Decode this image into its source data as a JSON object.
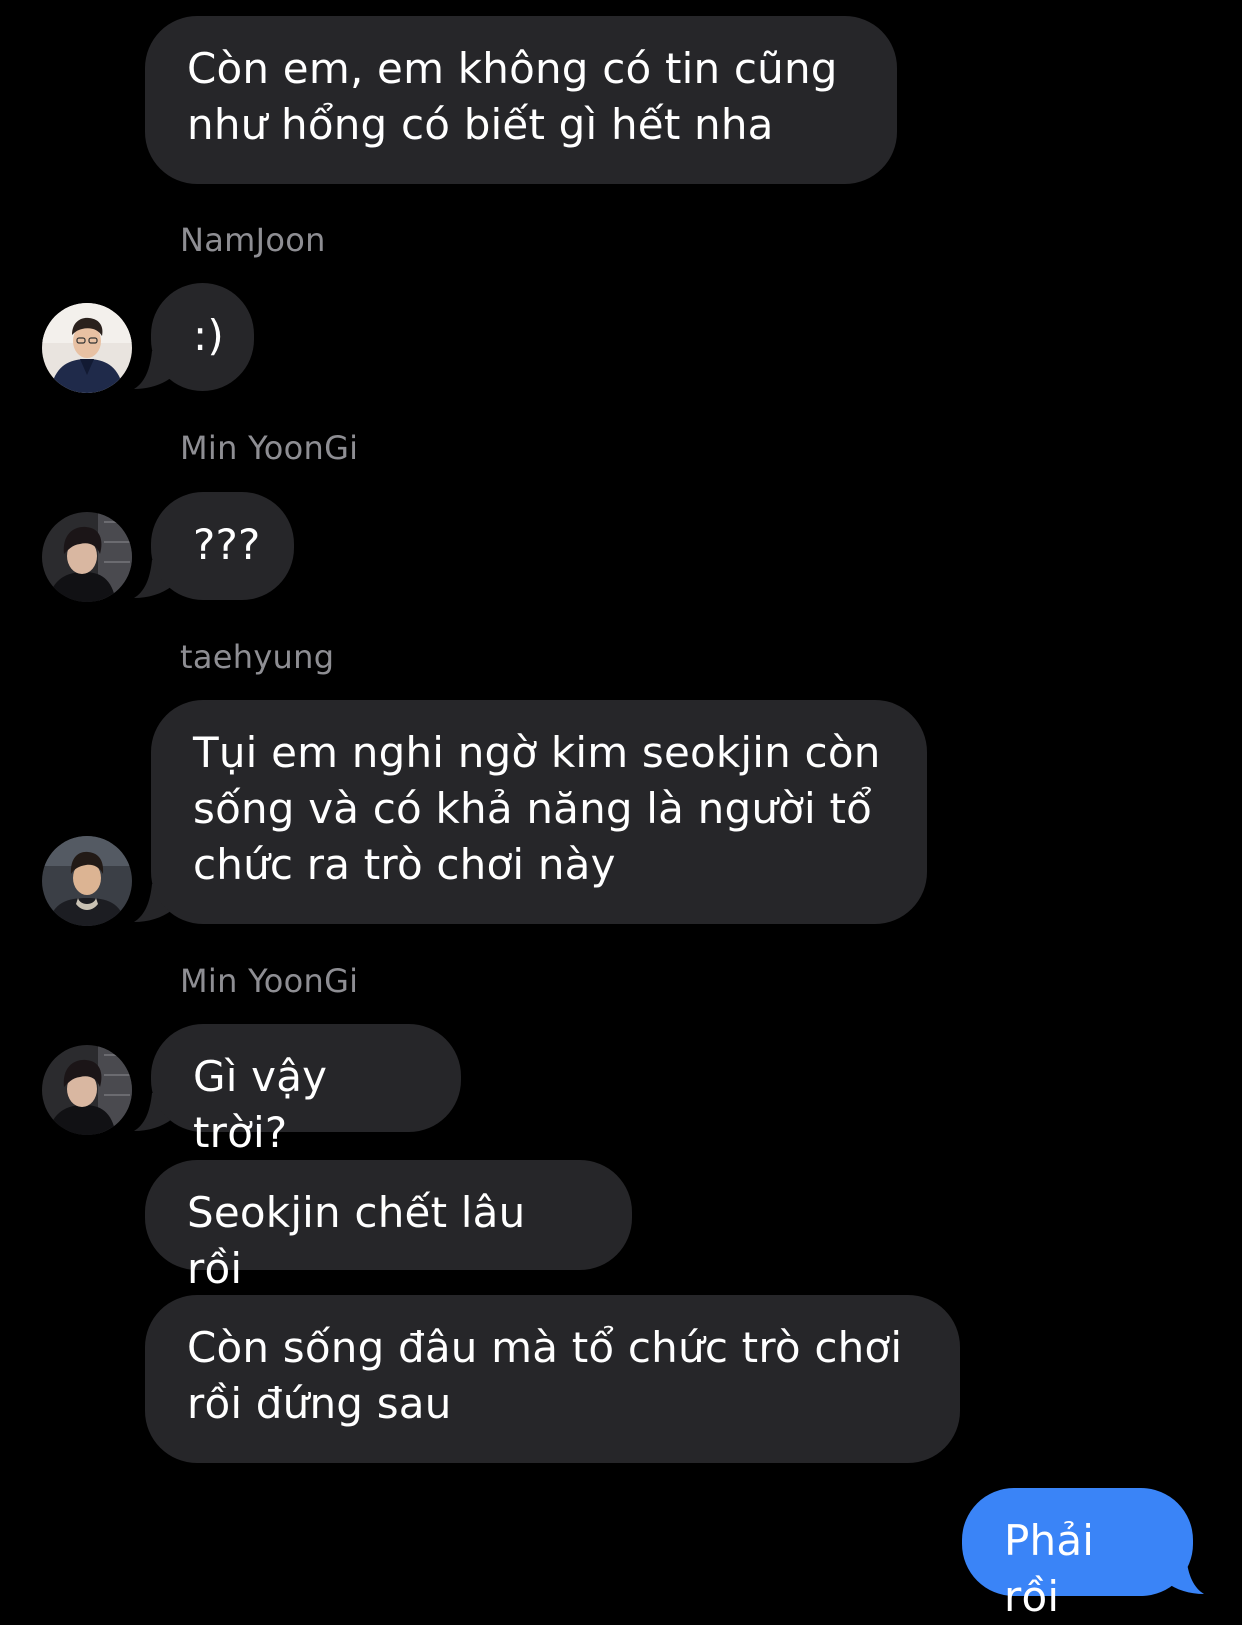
{
  "conversation": {
    "messages": [
      {
        "sender": "",
        "text": "Còn em, em không có tin cũng\nnhư hổng có biết gì hết nha",
        "direction": "incoming"
      },
      {
        "sender": "NamJoon",
        "text": ":)",
        "direction": "incoming",
        "avatar": "namjoon-avatar"
      },
      {
        "sender": "Min YoonGi",
        "text": "???",
        "direction": "incoming",
        "avatar": "yoongi-avatar"
      },
      {
        "sender": "taehyung",
        "text": "Tụi em nghi ngờ kim seokjin còn\nsống và có khả năng là người tổ\nchức ra trò chơi này",
        "direction": "incoming",
        "avatar": "taehyung-avatar"
      },
      {
        "sender": "Min YoonGi",
        "text": "Gì vậy trời?",
        "direction": "incoming",
        "avatar": "yoongi-avatar"
      },
      {
        "sender": "",
        "text": "Seokjin chết lâu rồi",
        "direction": "incoming"
      },
      {
        "sender": "",
        "text": "Còn sống đâu mà tổ chức trò chơi\nrồi đứng sau",
        "direction": "incoming"
      },
      {
        "sender": "",
        "text": "Phải rồi",
        "direction": "outgoing"
      }
    ]
  },
  "colors": {
    "background": "#000000",
    "incoming_bubble": "#262629",
    "outgoing_bubble": "#3a84f7",
    "sender_name": "#8e8e93",
    "text": "#ffffff"
  }
}
